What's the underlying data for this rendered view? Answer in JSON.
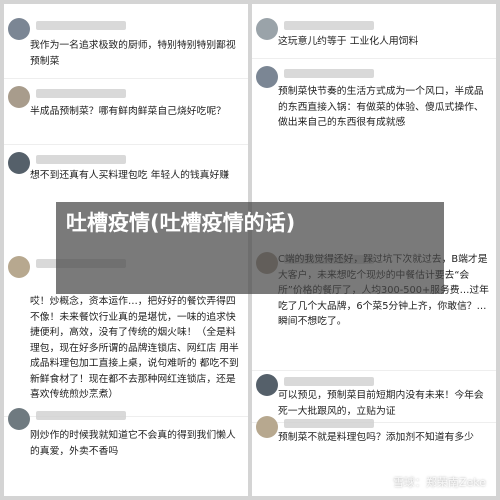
{
  "left_comments": [
    "我作为一名追求极致的厨师，特别特别特别鄙视预制菜",
    "半成品预制菜？哪有鲜肉鲜菜自己烧好吃呢？",
    "想不到还真有人买料理包吃 年轻人的钱真好赚",
    "哎！炒概念，资本运作…，把好好的餐饮弄得四不像！未来餐饮行业真的是堪忧，一味的追求快捷便利，高效，没有了传统的烟火味！（全是料理包，现在好多所谓的品牌连锁店、网红店 用半成品料理包加工直接上桌，说句难听的 都吃不到新鲜食材了！现在都不去那种网红连锁店，还是喜欢传统煎炒烹煮）",
    "刚炒作的时候我就知道它不会真的得到我们懒人的真爱，外卖不香吗"
  ],
  "right_comments": [
    "这玩意儿约等于 工业化人用饲料",
    "预制菜快节奏的生活方式成为一个风口，半成品的东西直接入锅：有做菜的体验、傻瓜式操作、做出来自己的东西很有成就感",
    "C端的我觉得还好，踩过坑下次就过去，B端才是大客户，未来想吃个现炒的中餐估计要去“会所”价格的餐厅了，人均300-500+服务费…过年吃了几个大品牌，6个菜5分钟上齐，你敢信？…瞬间不想吃了。",
    "可以预见，预制菜目前短期内没有未来！今年会死一大批跟风的，立贴为证",
    "预制菜不就是料理包吗？添加剂不知道有多少"
  ],
  "overlay": {
    "title": "吐槽疫情(吐槽疫情的话)"
  },
  "watermark": {
    "text": "雪球：郑荣南Zeke"
  }
}
